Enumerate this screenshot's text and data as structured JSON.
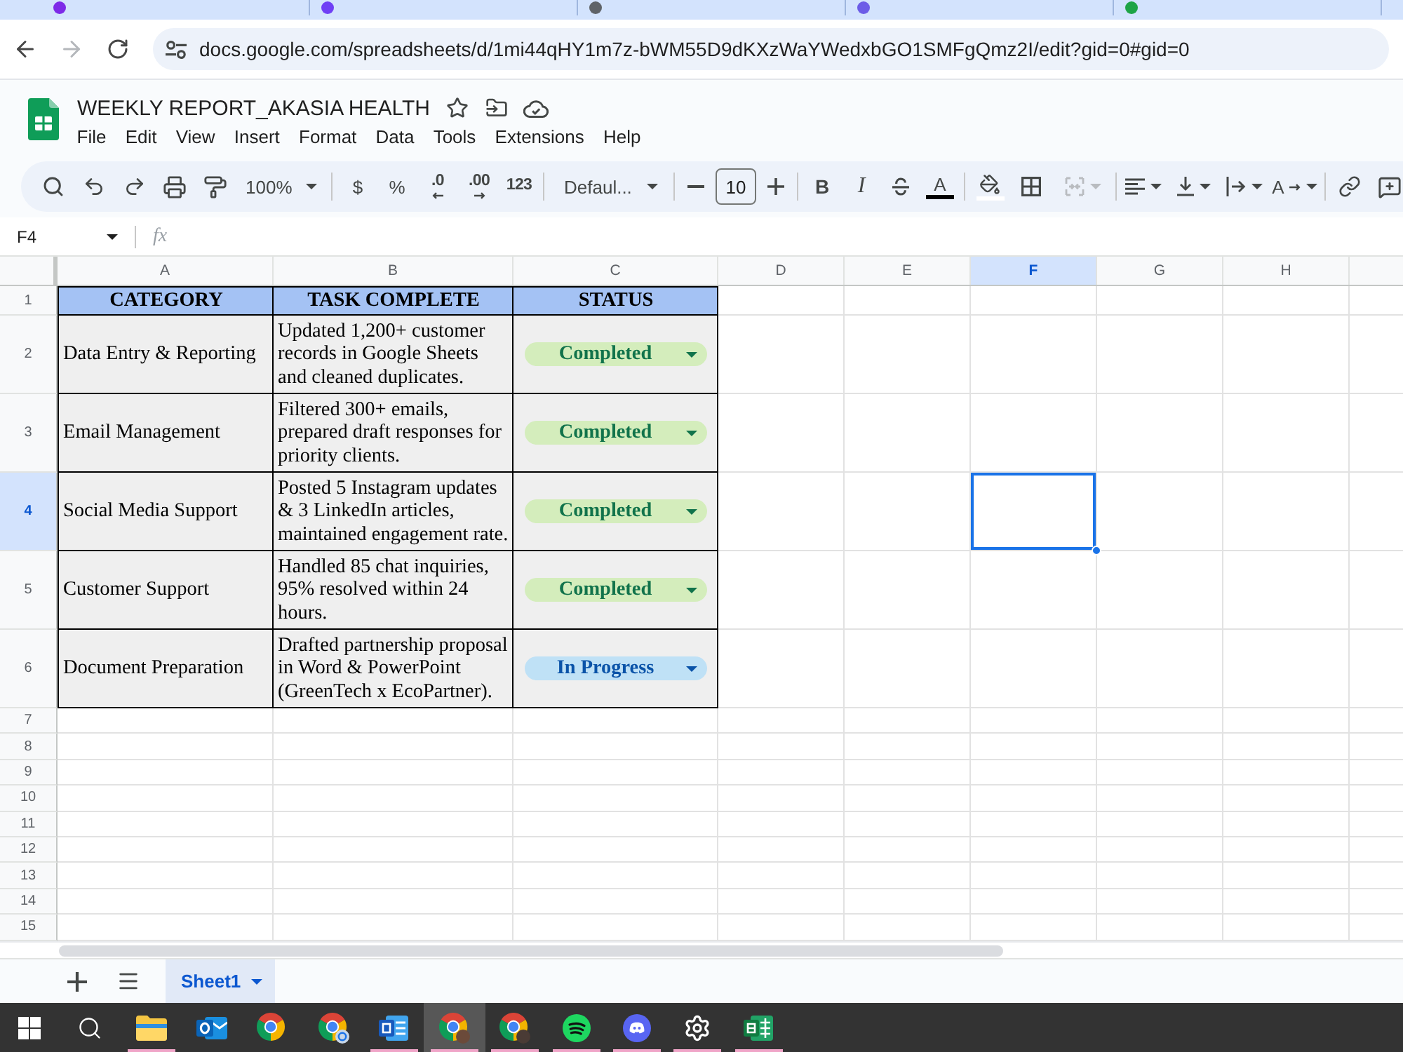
{
  "browser": {
    "forward_disabled": true,
    "url": "docs.google.com/spreadsheets/d/1mi44qHY1m7z-bWM55D9dKXzWaYWedxbGO1SMFgQmz2I/edit?gid=0#gid=0"
  },
  "document": {
    "title": "WEEKLY REPORT_AKASIA HEALTH",
    "menu": [
      "File",
      "Edit",
      "View",
      "Insert",
      "Format",
      "Data",
      "Tools",
      "Extensions",
      "Help"
    ]
  },
  "toolbar": {
    "zoom": "100%",
    "currency": "$",
    "percent": "%",
    "decrease_decimal": ".0",
    "increase_decimal": ".00",
    "number_format": "123",
    "font": "Defaul...",
    "font_size": "10",
    "bold": "B",
    "italic": "I",
    "text_color": "A",
    "merge_disabled": true,
    "text_rotation": "A"
  },
  "formula_bar": {
    "cell_reference": "F4",
    "function_label": "fx"
  },
  "grid": {
    "columns": [
      {
        "label": "A",
        "selected": false
      },
      {
        "label": "B",
        "selected": false
      },
      {
        "label": "C",
        "selected": false
      },
      {
        "label": "D",
        "selected": false
      },
      {
        "label": "E",
        "selected": false
      },
      {
        "label": "F",
        "selected": true
      },
      {
        "label": "G",
        "selected": false
      },
      {
        "label": "H",
        "selected": false
      }
    ],
    "rows": [
      {
        "label": "1",
        "selected": false
      },
      {
        "label": "2",
        "selected": false
      },
      {
        "label": "3",
        "selected": false
      },
      {
        "label": "4",
        "selected": true
      },
      {
        "label": "5",
        "selected": false
      },
      {
        "label": "6",
        "selected": false
      },
      {
        "label": "7",
        "selected": false
      },
      {
        "label": "8",
        "selected": false
      },
      {
        "label": "9",
        "selected": false
      },
      {
        "label": "10",
        "selected": false
      },
      {
        "label": "11",
        "selected": false
      },
      {
        "label": "12",
        "selected": false
      },
      {
        "label": "13",
        "selected": false
      },
      {
        "label": "14",
        "selected": false
      },
      {
        "label": "15",
        "selected": false
      }
    ]
  },
  "table": {
    "columns": [
      "CATEGORY",
      "TASK COMPLETE",
      "STATUS"
    ],
    "rows": [
      {
        "category": "Data Entry & Reporting",
        "task": "Updated 1,200+ customer records in Google Sheets and cleaned duplicates.",
        "status": {
          "kind": "completed",
          "label": "Completed"
        }
      },
      {
        "category": "Email Management",
        "task": "Filtered 300+ emails, prepared draft responses for priority clients.",
        "status": {
          "kind": "completed",
          "label": "Completed"
        }
      },
      {
        "category": "Social Media Support",
        "task": "Posted 5 Instagram updates & 3 LinkedIn articles, maintained engagement rate.",
        "status": {
          "kind": "completed",
          "label": "Completed"
        }
      },
      {
        "category": "Customer Support",
        "task": "Handled 85 chat inquiries, 95% resolved within 24 hours.",
        "status": {
          "kind": "completed",
          "label": "Completed"
        }
      },
      {
        "category": "Document Preparation",
        "task": "Drafted partnership proposal in Word & PowerPoint (GreenTech x EcoPartner).",
        "status": {
          "kind": "progress",
          "label": "In Progress"
        }
      }
    ]
  },
  "sheet_tabs": [
    {
      "label": "Sheet1",
      "selected": true
    }
  ],
  "taskbar": [
    {
      "kind": "start",
      "running": false,
      "selected": false
    },
    {
      "kind": "search",
      "running": false,
      "selected": false
    },
    {
      "kind": "folder",
      "running": true,
      "selected": false
    },
    {
      "kind": "mail",
      "running": false,
      "selected": false
    },
    {
      "kind": "browser",
      "running": false,
      "selected": false
    },
    {
      "kind": "browsersync",
      "running": false,
      "selected": false
    },
    {
      "kind": "document",
      "running": true,
      "selected": false
    },
    {
      "kind": "browseravatar",
      "running": true,
      "selected": true
    },
    {
      "kind": "browserphoto",
      "running": true,
      "selected": false
    },
    {
      "kind": "music",
      "running": true,
      "selected": false
    },
    {
      "kind": "chat",
      "running": true,
      "selected": false
    },
    {
      "kind": "settings",
      "running": true,
      "selected": false
    },
    {
      "kind": "spreadsheet",
      "running": true,
      "selected": false
    }
  ]
}
